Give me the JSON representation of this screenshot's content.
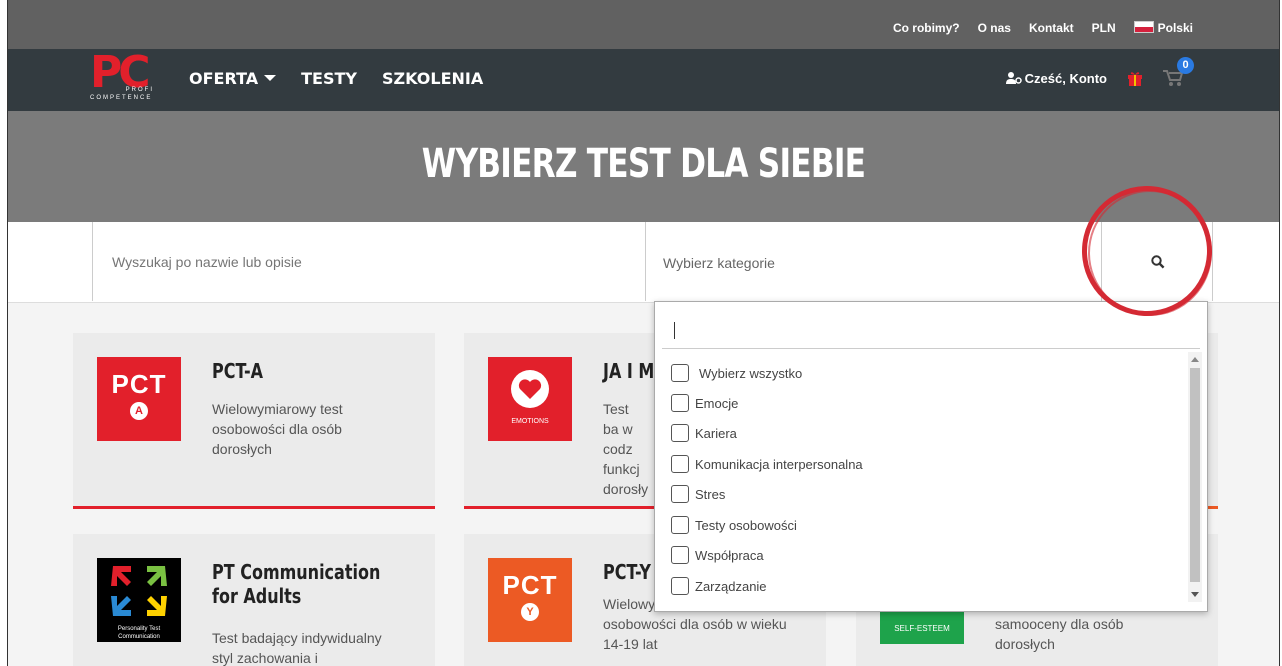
{
  "util_links": [
    "Co robimy?",
    "O nas",
    "Kontakt",
    "PLN",
    "Polski"
  ],
  "logo": {
    "main": "PC",
    "profi": "PROFI",
    "competence": "COMPETENCE"
  },
  "nav": {
    "items": [
      "OFERTA",
      "TESTY",
      "SZKOLENIA"
    ],
    "account": "Cześć, Konto",
    "cart_count": "0"
  },
  "hero_title": "WYBIERZ TEST DLA SIEBIE",
  "search": {
    "placeholder": "Wyszukaj po nazwie lub opisie",
    "category_placeholder": "Wybierz kategorie"
  },
  "cards": [
    {
      "title": "PCT-A",
      "desc": "Wielowymiarowy test osobowości dla osób dorosłych",
      "logo_text": "PCT",
      "logo_letter": "A"
    },
    {
      "title": "JA I M",
      "desc": "Test ba w codz funkcj dorosły",
      "logo_text": "EMOTIONS"
    },
    {
      "title": "PT Communication for Adults",
      "desc": "Test badający indywidualny styl zachowania i",
      "logo_text": "Personality Test Communication"
    },
    {
      "title": "PCT-Y",
      "desc": "Wielowymiarowy test osobowości dla osób w wieku 14-19 lat",
      "logo_text": "PCT",
      "logo_letter": "Y"
    },
    {
      "title": "",
      "desc": "Test badający poziom samooceny dla osób dorosłych",
      "logo_text": "SELF-ESTEEM"
    }
  ],
  "dropdown_options": [
    "Wybierz wszystko",
    "Emocje",
    "Kariera",
    "Komunikacja interpersonalna",
    "Stres",
    "Testy osobowości",
    "Współpraca",
    "Zarządzanie"
  ],
  "colors": {
    "brand_red": "#e2202b",
    "nav_dark": "#333b40",
    "hero_gray": "#7b7b7b",
    "annotation_red": "#d42a34",
    "badge_blue": "#2a7ae2"
  }
}
